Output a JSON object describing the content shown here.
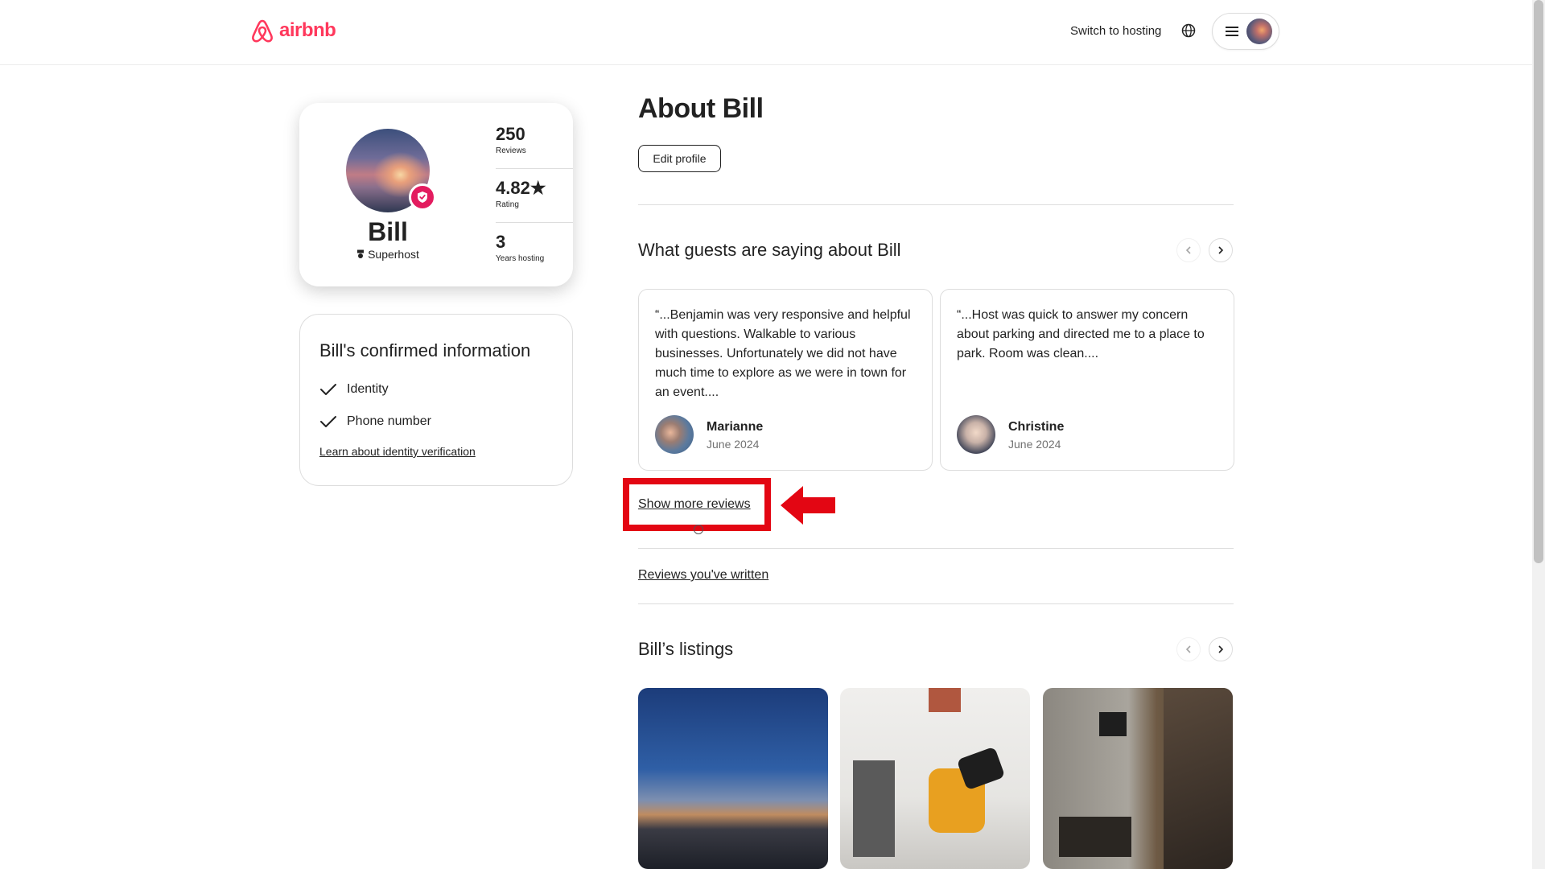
{
  "header": {
    "logo_text": "airbnb",
    "switch_hosting": "Switch to hosting",
    "brand_color": "#FF385C"
  },
  "profile": {
    "name": "Bill",
    "badge": "Superhost",
    "stats": [
      {
        "value": "250",
        "label": "Reviews"
      },
      {
        "value": "4.82★",
        "label": "Rating"
      },
      {
        "value": "3",
        "label": "Years hosting"
      }
    ]
  },
  "confirmed": {
    "title": "Bill's confirmed information",
    "items": [
      "Identity",
      "Phone number"
    ],
    "link": "Learn about identity verification"
  },
  "about": {
    "title": "About Bill",
    "edit_button": "Edit profile"
  },
  "reviews": {
    "title": "What guests are saying about Bill",
    "items": [
      {
        "text": "“...Benjamin was very responsive and helpful with questions. Walkable to various businesses. Unfortunately we did not have much time to explore as we were in town for an event....",
        "name": "Marianne",
        "date": "June 2024"
      },
      {
        "text": "“...Host was quick to answer my concern about parking and directed me to a place to park. Room was clean....",
        "name": "Christine",
        "date": "June 2024"
      }
    ],
    "show_more": "Show more reviews",
    "written_link": "Reviews you've written"
  },
  "listings": {
    "title": "Bill’s listings"
  },
  "annotation": {
    "highlight_color": "#E30613"
  }
}
